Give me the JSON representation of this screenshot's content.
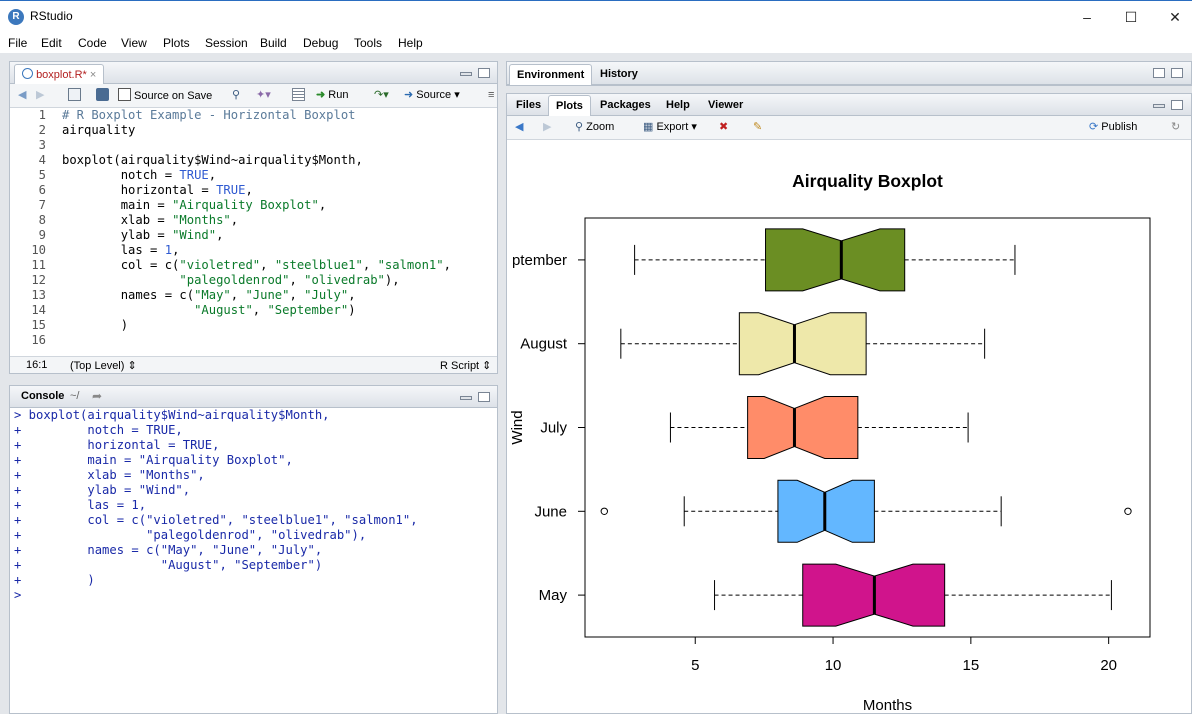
{
  "window": {
    "title": "RStudio",
    "logo_letter": "R"
  },
  "menu": [
    "File",
    "Edit",
    "Code",
    "View",
    "Plots",
    "Session",
    "Build",
    "Debug",
    "Tools",
    "Help"
  ],
  "editor": {
    "tab_label": "boxplot.R*",
    "toolbar": {
      "source_on_save": "Source on Save",
      "run": "Run",
      "source": "Source"
    },
    "lines": [
      "# R Boxplot Example - Horizontal Boxplot",
      "airquality",
      "",
      "boxplot(airquality$Wind~airquality$Month,",
      "        notch = TRUE,",
      "        horizontal = TRUE,",
      "        main = \"Airquality Boxplot\",",
      "        xlab = \"Months\",",
      "        ylab = \"Wind\",",
      "        las = 1,",
      "        col = c(\"violetred\", \"steelblue1\", \"salmon1\",",
      "                \"palegoldenrod\", \"olivedrab\"),",
      "        names = c(\"May\", \"June\", \"July\",",
      "                  \"August\", \"September\")",
      "        )",
      ""
    ],
    "status": {
      "position": "16:1",
      "scope": "(Top Level)",
      "filetype": "R Script"
    }
  },
  "console": {
    "title": "Console",
    "path": "~/",
    "lines": [
      "> boxplot(airquality$Wind~airquality$Month,",
      "+         notch = TRUE,",
      "+         horizontal = TRUE,",
      "+         main = \"Airquality Boxplot\",",
      "+         xlab = \"Months\",",
      "+         ylab = \"Wind\",",
      "+         las = 1,",
      "+         col = c(\"violetred\", \"steelblue1\", \"salmon1\",",
      "+                 \"palegoldenrod\", \"olivedrab\"),",
      "+         names = c(\"May\", \"June\", \"July\",",
      "+                   \"August\", \"September\")",
      "+         )",
      "> "
    ]
  },
  "env_pane": {
    "tabs": [
      "Environment",
      "History"
    ]
  },
  "files_pane": {
    "tabs": [
      "Files",
      "Plots",
      "Packages",
      "Help",
      "Viewer"
    ],
    "active_tab": "Plots",
    "toolbar": {
      "zoom": "Zoom",
      "export": "Export",
      "publish": "Publish"
    }
  },
  "chart_data": {
    "type": "boxplot",
    "orientation": "horizontal",
    "notch": true,
    "title": "Airquality Boxplot",
    "xlabel": "Months",
    "ylabel": "Wind",
    "xlim": [
      1.0,
      21.5
    ],
    "xticks": [
      5,
      10,
      15,
      20
    ],
    "categories": [
      "May",
      "June",
      "July",
      "August",
      "September"
    ],
    "category_labels_shown": [
      "May",
      "June",
      "July",
      "August",
      "ptember"
    ],
    "colors": [
      "#d0148c",
      "#63b7ff",
      "#ff8c69",
      "#eee8aa",
      "#6b8e23"
    ],
    "series": [
      {
        "name": "May",
        "whisker_low": 5.7,
        "q1": 8.9,
        "median": 11.5,
        "q3": 14.05,
        "whisker_high": 20.1,
        "notch_low": 10.1,
        "notch_high": 12.9,
        "outliers": []
      },
      {
        "name": "June",
        "whisker_low": 4.6,
        "q1": 8.0,
        "median": 9.7,
        "q3": 11.5,
        "whisker_high": 16.1,
        "notch_low": 8.7,
        "notch_high": 10.7,
        "outliers": [
          1.7,
          20.7
        ]
      },
      {
        "name": "July",
        "whisker_low": 4.1,
        "q1": 6.9,
        "median": 8.6,
        "q3": 10.9,
        "whisker_high": 14.9,
        "notch_low": 7.5,
        "notch_high": 9.7,
        "outliers": []
      },
      {
        "name": "August",
        "whisker_low": 2.3,
        "q1": 6.6,
        "median": 8.6,
        "q3": 11.2,
        "whisker_high": 15.5,
        "notch_low": 7.3,
        "notch_high": 9.9,
        "outliers": []
      },
      {
        "name": "September",
        "whisker_low": 2.8,
        "q1": 7.55,
        "median": 10.3,
        "q3": 12.6,
        "whisker_high": 16.6,
        "notch_low": 8.9,
        "notch_high": 11.7,
        "outliers": []
      }
    ]
  }
}
